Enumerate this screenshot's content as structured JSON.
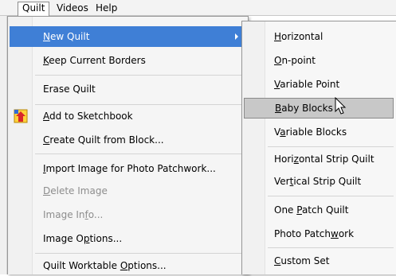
{
  "menubar": {
    "items": [
      {
        "label": "Quilt",
        "active": true
      },
      {
        "label": "Videos",
        "active": false
      },
      {
        "label": "Help",
        "active": false
      }
    ]
  },
  "main_menu": {
    "items": [
      {
        "label": "New Quilt",
        "has_submenu": true,
        "highlighted": true,
        "mnemonic": "N"
      },
      {
        "label": "Keep Current Borders",
        "mnemonic": "K"
      },
      {
        "label": "Erase Quilt"
      },
      {
        "label": "Add to Sketchbook",
        "icon": "sketchbook-icon",
        "mnemonic": "A"
      },
      {
        "label": "Create Quilt from Block...",
        "mnemonic": "C"
      },
      {
        "label": "Import Image for Photo Patchwork...",
        "mnemonic": "I"
      },
      {
        "label": "Delete Image",
        "disabled": true,
        "mnemonic": "D"
      },
      {
        "label": "Image Info...",
        "disabled": true,
        "mnemonic": "f"
      },
      {
        "label": "Image Options...",
        "mnemonic": "p"
      },
      {
        "label": "Quilt Worktable Options...",
        "mnemonic": "O"
      }
    ]
  },
  "sub_menu": {
    "items": [
      {
        "label": "Horizontal",
        "mnemonic": "H"
      },
      {
        "label": "On-point",
        "mnemonic": "O"
      },
      {
        "label": "Variable Point",
        "mnemonic": "V"
      },
      {
        "label": "Baby Blocks",
        "hovered": true,
        "mnemonic": "B"
      },
      {
        "label": "Variable Blocks",
        "mnemonic": "a"
      },
      {
        "label": "Horizontal Strip Quilt",
        "mnemonic": "z"
      },
      {
        "label": "Vertical Strip Quilt",
        "mnemonic": "t"
      },
      {
        "label": "One Patch Quilt",
        "mnemonic": "P"
      },
      {
        "label": "Photo Patchwork",
        "mnemonic": "w"
      },
      {
        "label": "Custom Set",
        "mnemonic": "C"
      }
    ]
  },
  "colors": {
    "highlight": "#3f7fd6",
    "hover": "#c8c8c8",
    "disabled_text": "#8d8d8d"
  }
}
